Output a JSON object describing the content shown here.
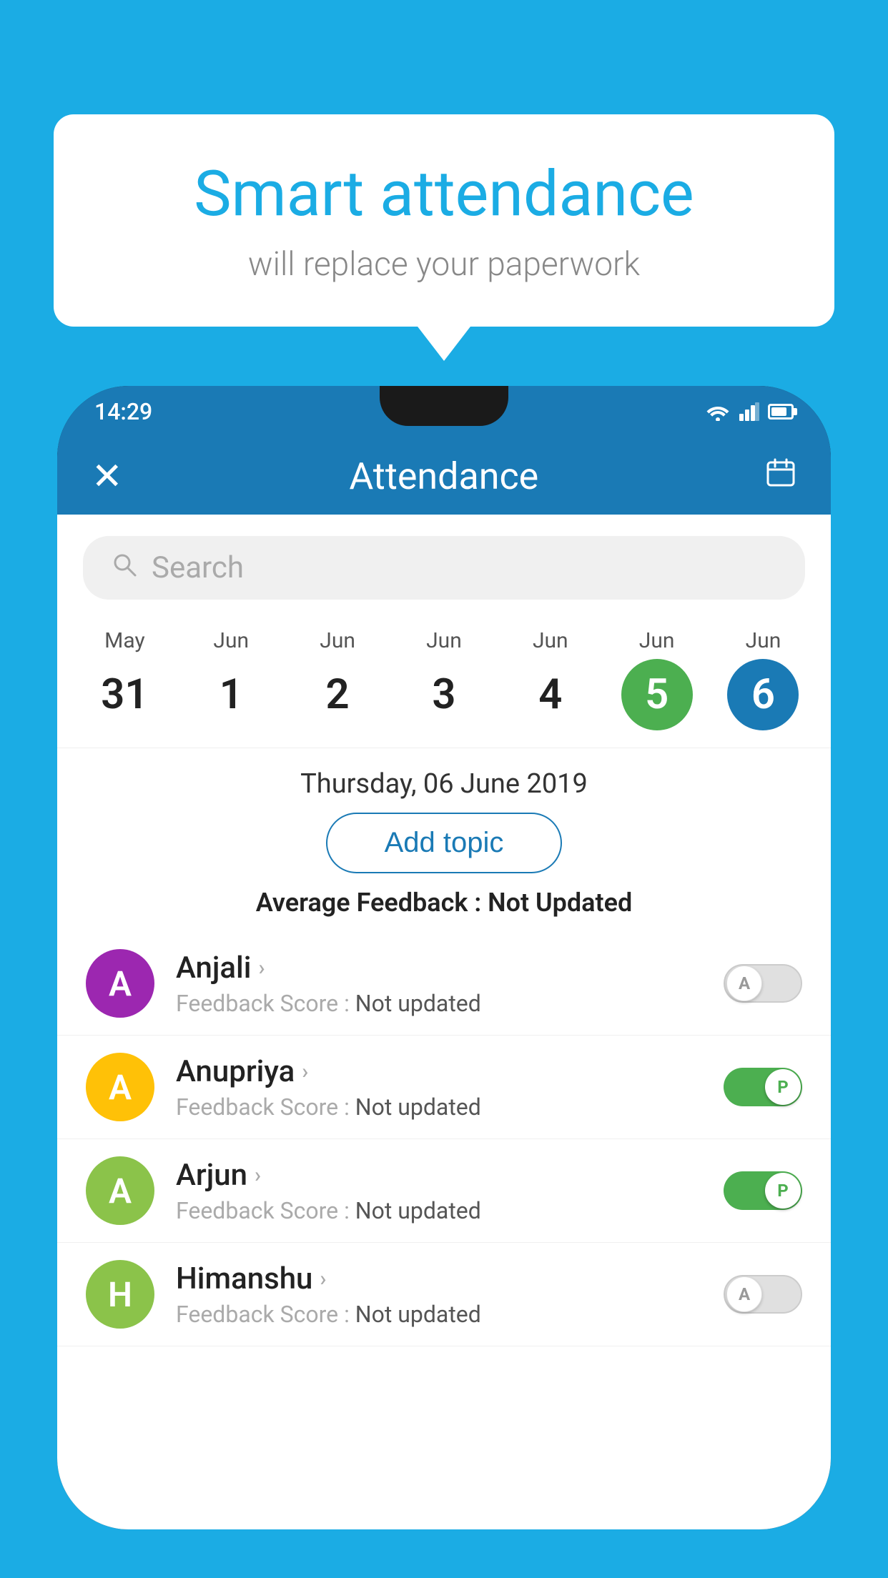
{
  "background_color": "#1BACE4",
  "speech_bubble": {
    "title": "Smart attendance",
    "subtitle": "will replace your paperwork"
  },
  "status_bar": {
    "time": "14:29",
    "icons": [
      "wifi",
      "signal",
      "battery"
    ]
  },
  "app_header": {
    "title": "Attendance",
    "close_label": "✕",
    "calendar_label": "📅"
  },
  "search": {
    "placeholder": "Search"
  },
  "calendar": {
    "days": [
      {
        "month": "May",
        "date": "31",
        "state": "normal"
      },
      {
        "month": "Jun",
        "date": "1",
        "state": "normal"
      },
      {
        "month": "Jun",
        "date": "2",
        "state": "normal"
      },
      {
        "month": "Jun",
        "date": "3",
        "state": "normal"
      },
      {
        "month": "Jun",
        "date": "4",
        "state": "normal"
      },
      {
        "month": "Jun",
        "date": "5",
        "state": "today"
      },
      {
        "month": "Jun",
        "date": "6",
        "state": "selected"
      }
    ]
  },
  "selected_date_label": "Thursday, 06 June 2019",
  "add_topic_label": "Add topic",
  "avg_feedback": {
    "label": "Average Feedback : ",
    "value": "Not Updated"
  },
  "students": [
    {
      "name": "Anjali",
      "avatar_letter": "A",
      "avatar_color": "#9C27B0",
      "feedback_label": "Feedback Score : ",
      "feedback_value": "Not updated",
      "toggle_state": "off",
      "toggle_label": "A"
    },
    {
      "name": "Anupriya",
      "avatar_letter": "A",
      "avatar_color": "#FFC107",
      "feedback_label": "Feedback Score : ",
      "feedback_value": "Not updated",
      "toggle_state": "on",
      "toggle_label": "P"
    },
    {
      "name": "Arjun",
      "avatar_letter": "A",
      "avatar_color": "#8BC34A",
      "feedback_label": "Feedback Score : ",
      "feedback_value": "Not updated",
      "toggle_state": "on",
      "toggle_label": "P"
    },
    {
      "name": "Himanshu",
      "avatar_letter": "H",
      "avatar_color": "#8BC34A",
      "feedback_label": "Feedback Score : ",
      "feedback_value": "Not updated",
      "toggle_state": "off",
      "toggle_label": "A"
    }
  ]
}
